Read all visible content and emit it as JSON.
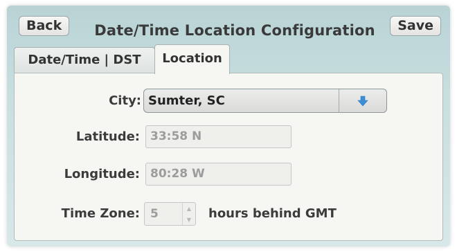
{
  "header": {
    "back_label": "Back",
    "title": "Date/Time Location Configuration",
    "save_label": "Save"
  },
  "tabs": [
    {
      "label": "Date/Time | DST",
      "active": false
    },
    {
      "label": "Location",
      "active": true
    }
  ],
  "form": {
    "city": {
      "label": "City:",
      "value": "Sumter, SC",
      "icon": "arrow-down-icon"
    },
    "latitude": {
      "label": "Latitude:",
      "value": "33:58 N"
    },
    "longitude": {
      "label": "Longitude:",
      "value": "80:28 W"
    },
    "time_zone": {
      "label": "Time Zone:",
      "value": "5",
      "suffix": "hours behind GMT"
    }
  },
  "colors": {
    "arrow": "#3a8fd6",
    "window_bg": "#c9dfe0",
    "panel_bg": "#f6f6f3"
  }
}
